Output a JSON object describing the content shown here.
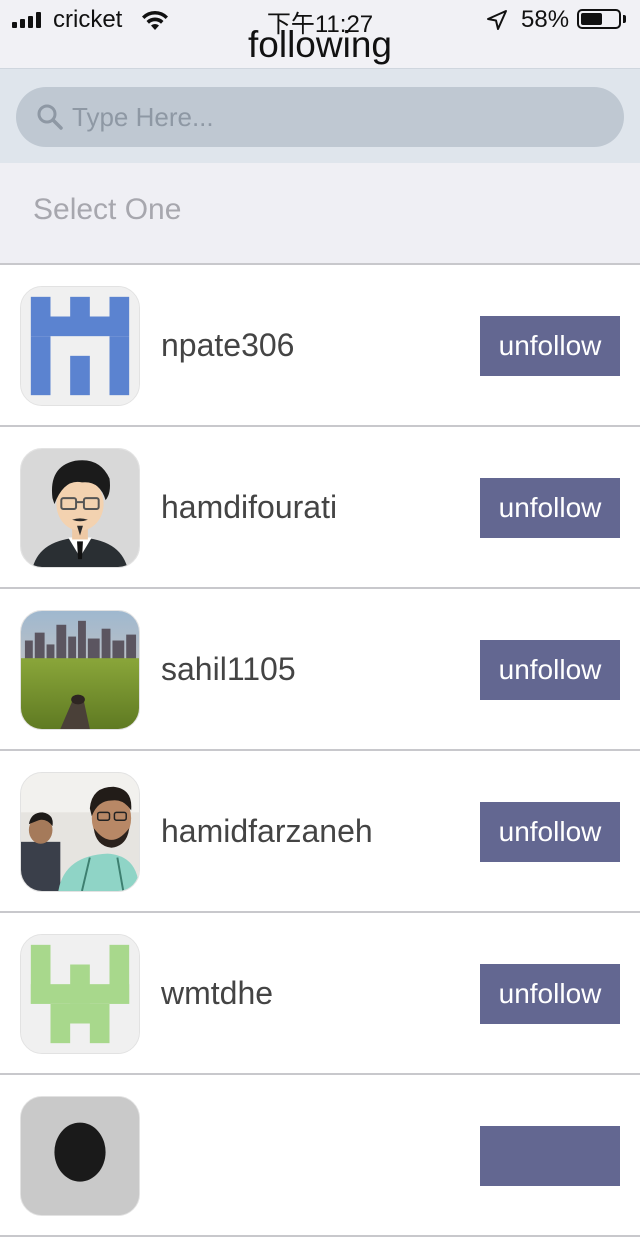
{
  "status_bar": {
    "carrier": "cricket",
    "time": "下午11:27",
    "battery": "58%",
    "battery_level": 0.58,
    "icons": [
      "signal-icon",
      "wifi-icon",
      "location-arrow-icon",
      "battery-icon"
    ]
  },
  "header": {
    "title": "following"
  },
  "search": {
    "placeholder": "Type Here...",
    "value": "",
    "icon": "search-icon"
  },
  "filter": {
    "label": "Select One"
  },
  "users": [
    {
      "username": "npate306",
      "button": "unfollow",
      "avatar": "blue-identicon-avatar"
    },
    {
      "username": "hamdifourati",
      "button": "unfollow",
      "avatar": "cartoon-man-avatar"
    },
    {
      "username": "sahil1105",
      "button": "unfollow",
      "avatar": "city-park-photo-avatar"
    },
    {
      "username": "hamidfarzaneh",
      "button": "unfollow",
      "avatar": "selfie-photo-avatar"
    },
    {
      "username": "wmtdhe",
      "button": "unfollow",
      "avatar": "green-identicon-avatar"
    },
    {
      "username": "",
      "button": "",
      "avatar": "gray-person-avatar"
    }
  ],
  "colors": {
    "button": "#636791",
    "search_area": "#dfe5ec",
    "search_box": "#bfc8d2",
    "select_area": "#efeff4"
  }
}
